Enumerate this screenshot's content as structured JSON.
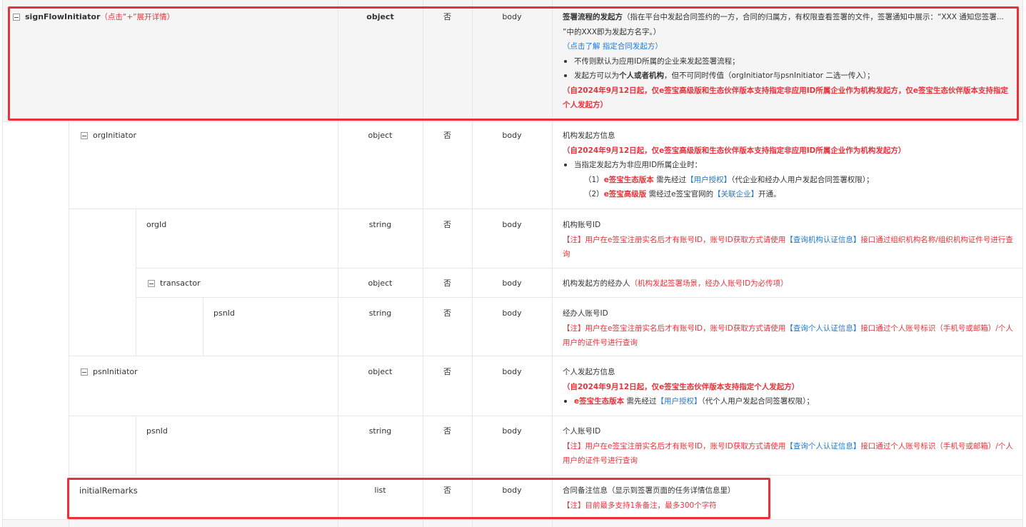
{
  "colors": {
    "red": "#e8323a",
    "link": "#1f78d1",
    "grid": "#e6e6e6",
    "row_bg": "#f5f5f5"
  },
  "rows": {
    "signFlowInitiator": {
      "name": "signFlowInitiator",
      "expand_hint": "（点击“+”展开详情）",
      "type": "object",
      "required": "否",
      "position": "body",
      "d1a": "签署流程的发起方",
      "d1b": "（指在平台中发起合同签约的一方，合同的归属方，有权限查看签署的文件，签署通知中展示：“XXX 通知您签署... ”中的XXX即为发起方名字。）",
      "d2a": "（点击了解 ",
      "d2b": "指定合同发起方",
      "d2c": "）",
      "b1": "不传则默认为应用ID所属的企业来发起签署流程；",
      "b2a": "发起方可以为",
      "b2b": "个人或者机构",
      "b2c": "，但不可同时传值（orgInitiator与psnInitiator 二选一传入）；",
      "note": "（自2024年9月12日起，仅e签宝高级版和生态伙伴版本支持指定非应用ID所属企业作为机构发起方，仅e签宝生态伙伴版本支持指定个人发起方）"
    },
    "orgInitiator": {
      "name": "orgInitiator",
      "type": "object",
      "required": "否",
      "position": "body",
      "d1": "机构发起方信息",
      "d2": "（自2024年9月12日起，仅e签宝高级版和生态伙伴版本支持指定非应用ID所属企业作为机构发起方）",
      "b1": "当指定发起方为非应用ID所属企业时：",
      "s1a": "（1）",
      "s1b": "e签宝生态版本",
      "s1c": " 需先经过",
      "s1d": "【用户授权】",
      "s1e": "（代企业和经办人用户发起合同签署权限）；",
      "s2a": "（2）",
      "s2b": "e签宝高级版",
      "s2c": " 需经过e签宝官网的",
      "s2d": "【关联企业】",
      "s2e": "开通。"
    },
    "orgId": {
      "name": "orgId",
      "type": "string",
      "required": "否",
      "position": "body",
      "d1": "机构账号ID",
      "d2a": "【注】用户在e签宝注册实名后才有账号ID，账号ID获取方式请使用",
      "d2b": "【查询机构认证信息】",
      "d2c": "接口通过组织机构名称/组织机构证件号进行查询"
    },
    "transactor": {
      "name": "transactor",
      "type": "object",
      "required": "否",
      "position": "body",
      "d1a": "机构发起方的经办人",
      "d1b": "（机构发起签署场景，经办人账号ID为必传项）"
    },
    "psnId1": {
      "name": "psnId",
      "type": "string",
      "required": "否",
      "position": "body",
      "d1": "经办人账号ID",
      "d2a": "【注】用户在e签宝注册实名后才有账号ID，账号ID获取方式请使用",
      "d2b": "【查询个人认证信息】",
      "d2c": "接口通过个人账号标识（手机号或邮箱）/个人用户的证件号进行查询"
    },
    "psnInitiator": {
      "name": "psnInitiator",
      "type": "object",
      "required": "否",
      "position": "body",
      "d1": "个人发起方信息",
      "d2": "（自2024年9月12日起，仅e签宝生态伙伴版本支持指定个人发起方）",
      "b1a": "e签宝生态版本",
      "b1b": " 需先经过",
      "b1c": "【用户授权】",
      "b1d": "（代个人用户发起合同签署权限）；"
    },
    "psnId2": {
      "name": "psnId",
      "type": "string",
      "required": "否",
      "position": "body",
      "d1": "个人账号ID",
      "d2a": "【注】用户在e签宝注册实名后才有账号ID，账号ID获取方式请使用",
      "d2b": "【查询个人认证信息】",
      "d2c": "接口通过个人账号标识（手机号或邮箱）/个人用户的证件号进行查询"
    },
    "initialRemarks": {
      "name": "initialRemarks",
      "type": "list",
      "required": "否",
      "position": "body",
      "d1": "合同备注信息（显示到签署页面的任务详情信息里）",
      "d2": "【注】目前最多支持1条备注，最多300个字符"
    }
  }
}
